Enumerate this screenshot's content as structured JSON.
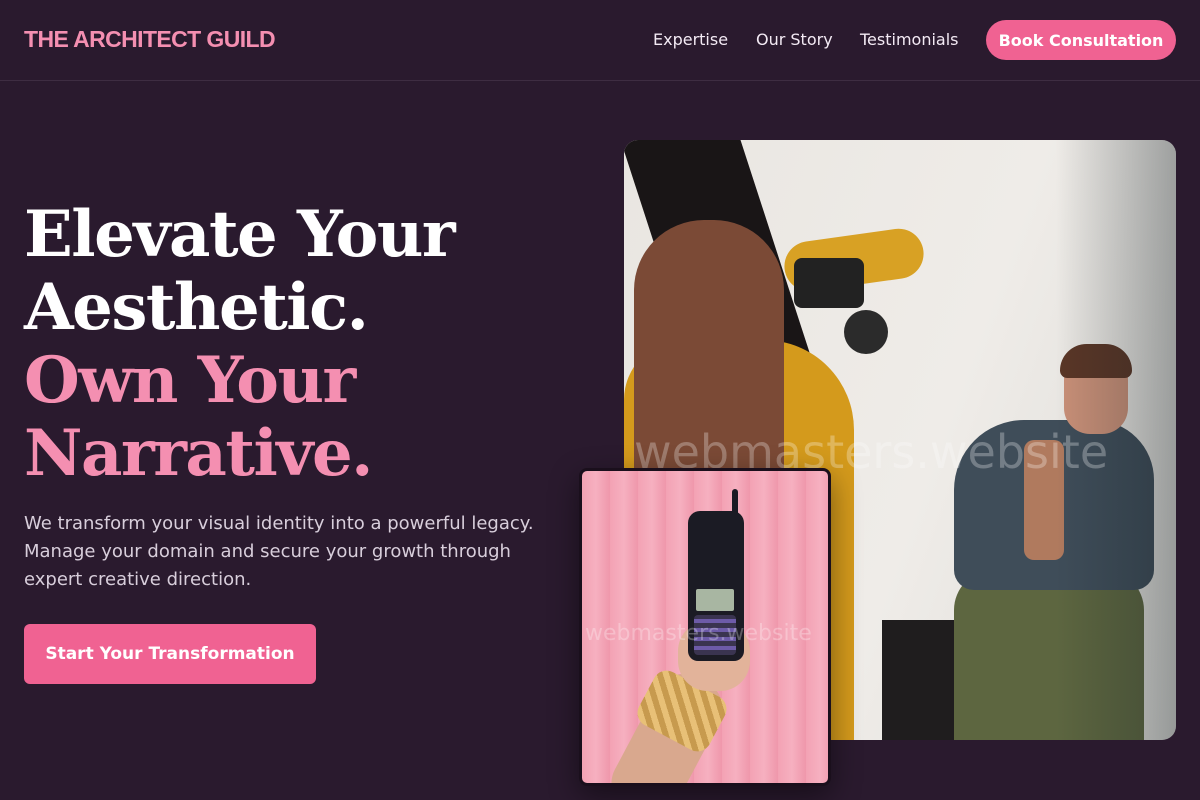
{
  "header": {
    "logo": "THE ARCHITECT GUILD",
    "nav": [
      "Expertise",
      "Our Story",
      "Testimonials"
    ],
    "cta": "Book Consultation"
  },
  "hero": {
    "title_lines": [
      "Elevate Your",
      "Aesthetic."
    ],
    "accent_lines": [
      "Own Your",
      "Narrative."
    ],
    "description": "We transform your visual identity into a powerful legacy. Manage your domain and secure your growth through expert creative direction.",
    "cta": "Start Your Transformation"
  },
  "images": {
    "main_watermark": "webmasters.website",
    "inset_watermark": "webmasters.website"
  },
  "colors": {
    "background": "#2a1a2e",
    "accent": "#f48fb1",
    "button": "#f06292"
  }
}
